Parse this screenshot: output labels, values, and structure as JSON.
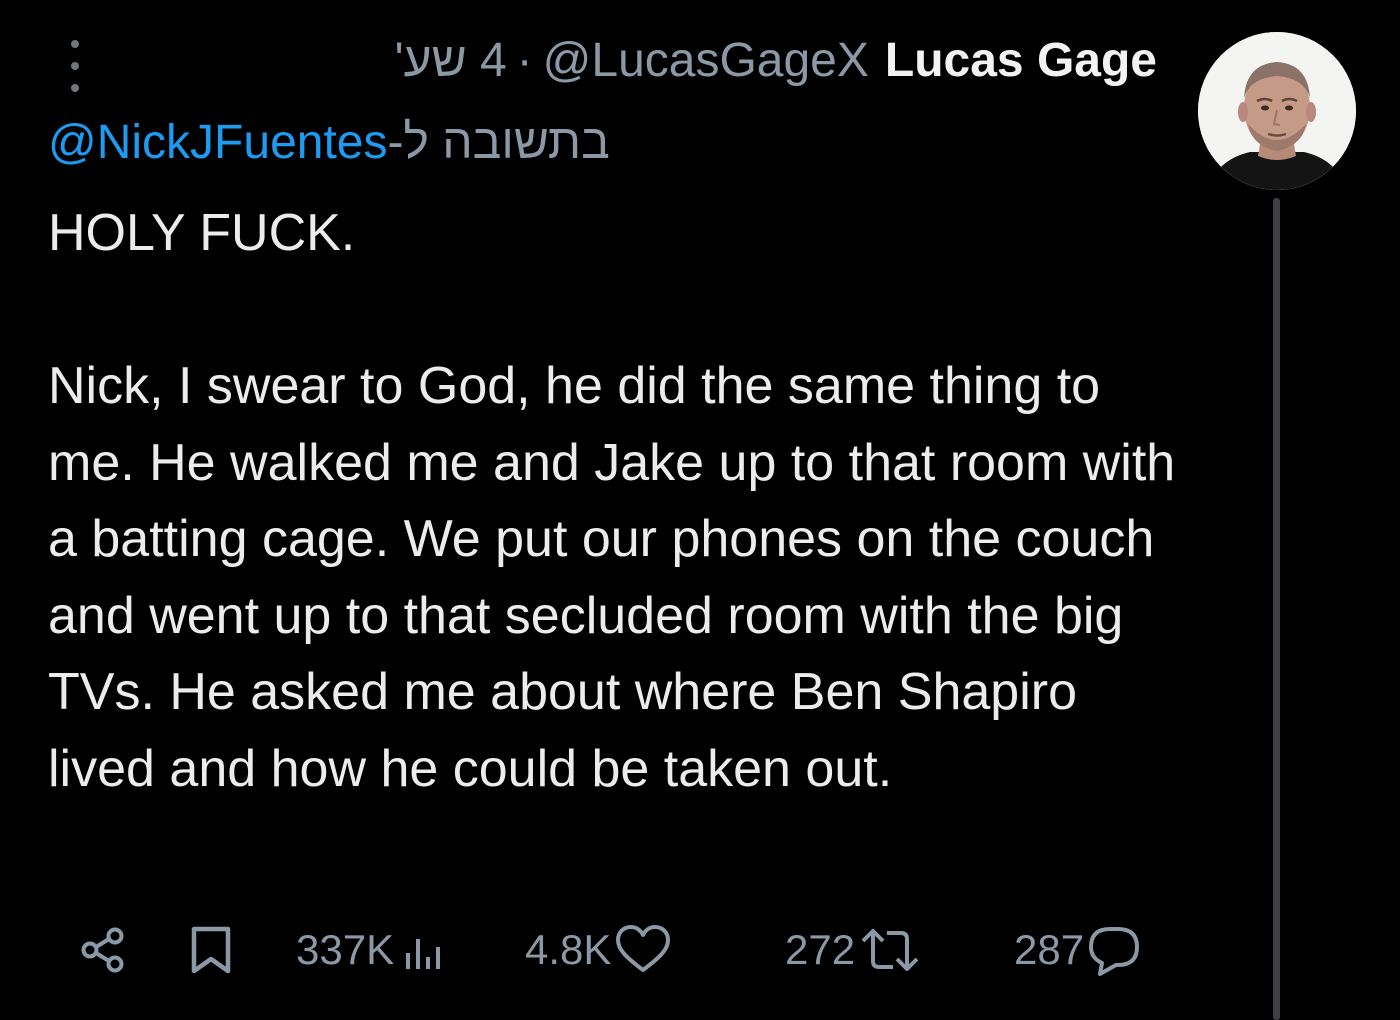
{
  "header": {
    "display_name": "Lucas Gage",
    "handle": "@LucasGageX",
    "separator": "·",
    "timestamp": "4 שע'"
  },
  "reply": {
    "label": "בתשובה ל-",
    "mention": "@NickJFuentes"
  },
  "tweet": {
    "paragraphs": [
      "HOLY FUCK.",
      "Nick, I swear to God, he did the same thing to me. He walked me and Jake up to that room with a batting cage. We put our phones on the couch and went up to that secluded room with the big TVs. He asked me about where Ben Shapiro lived and how he could be taken out."
    ]
  },
  "actions": {
    "views": "337K",
    "likes": "4.8K",
    "reposts": "272",
    "replies": "287"
  },
  "icons": {
    "more": "more-vertical-icon",
    "share": "share-icon",
    "bookmark": "bookmark-icon",
    "views": "views-bar-chart-icon",
    "like": "heart-icon",
    "repost": "repost-icon",
    "reply": "reply-bubble-icon"
  },
  "colors": {
    "background": "#000000",
    "text": "#e7e9ea",
    "secondary": "#8b98a5",
    "link": "#1d9bf0",
    "thread_line": "#3e4144"
  }
}
